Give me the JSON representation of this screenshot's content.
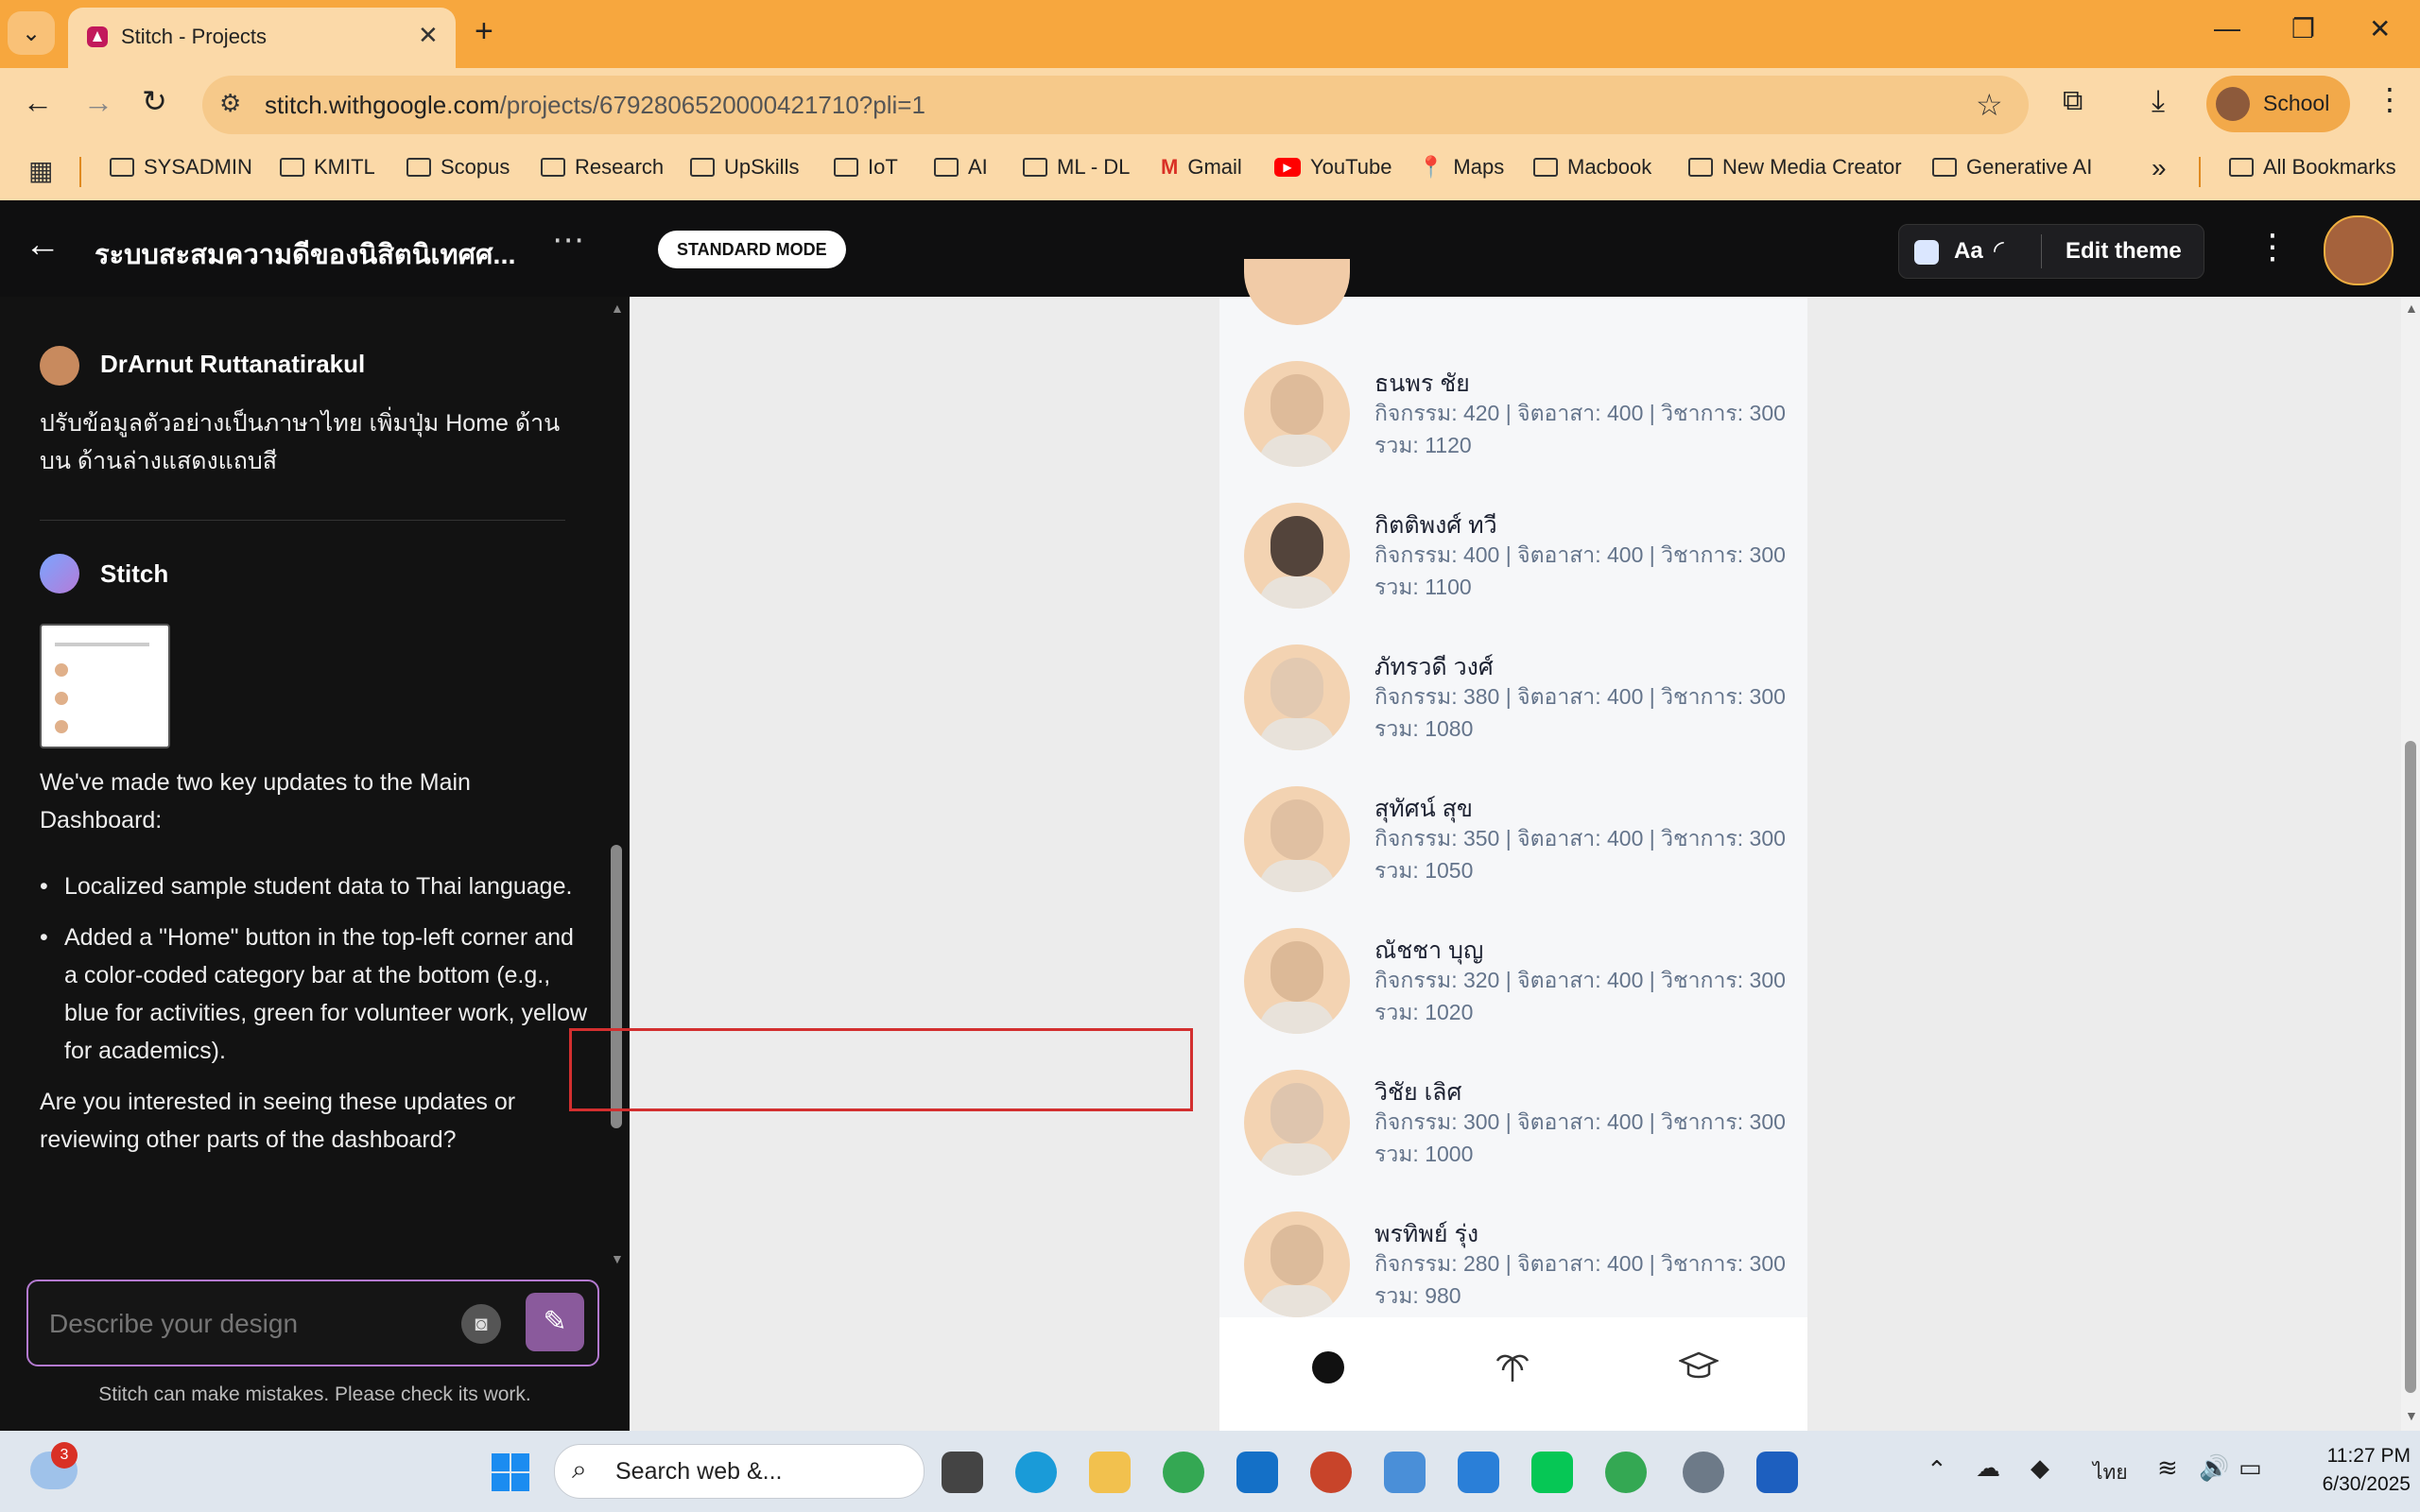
{
  "browser": {
    "tab_title": "Stitch - Projects",
    "url_host": "stitch.withgoogle.com",
    "url_path": "/projects/6792806520000421710?pli=1",
    "profile_label": "School",
    "bookmarks": [
      "SYSADMIN",
      "KMITL",
      "Scopus",
      "Research",
      "UpSkills",
      "IoT",
      "AI",
      "ML - DL",
      "Gmail",
      "YouTube",
      "Maps",
      "Macbook",
      "New Media Creator",
      "Generative AI"
    ],
    "all_bookmarks": "All Bookmarks"
  },
  "app": {
    "project_title": "ระบบสะสมความดีของนิสิตนิเทศศ...",
    "mode_label": "STANDARD MODE",
    "theme_label": "Aa",
    "edit_theme": "Edit theme"
  },
  "chat": {
    "user_name": "DrArnut Ruttanatirakul",
    "user_message": "ปรับข้อมูลตัวอย่างเป็นภาษาไทย เพิ่มปุ่ม Home ด้านบน ด้านล่างแสดงแถบสี",
    "assistant_name": "Stitch",
    "intro": "We've made two key updates to the Main Dashboard:",
    "bullets": [
      "Localized sample student data to Thai language.",
      "Added a \"Home\" button in the top-left corner and a color-coded category bar at the bottom (e.g., blue for activities, green for volunteer work, yellow for academics)."
    ],
    "question": "Are you interested in seeing these updates or reviewing other parts of the dashboard?",
    "input_placeholder": "Describe your design",
    "disclaimer": "Stitch can make mistakes. Please check its work."
  },
  "students": [
    {
      "name": "ธนพร ชัย",
      "scores": "กิจกรรม: 420 | จิตอาสา: 400 | วิชาการ: 300",
      "total": "รวม: 1120",
      "tone": "#f1cba7"
    },
    {
      "name": "กิตติพงศ์ ทวี",
      "scores": "กิจกรรม: 400 | จิตอาสา: 400 | วิชาการ: 300",
      "total": "รวม: 1100",
      "tone": "#5a4a40"
    },
    {
      "name": "ภัทรวดี วงศ์",
      "scores": "กิจกรรม: 380 | จิตอาสา: 400 | วิชาการ: 300",
      "total": "รวม: 1080",
      "tone": "#f6dac0"
    },
    {
      "name": "สุทัศน์ สุข",
      "scores": "กิจกรรม: 350 | จิตอาสา: 400 | วิชาการ: 300",
      "total": "รวม: 1050",
      "tone": "#f3d1b0"
    },
    {
      "name": "ณัชชา บุญ",
      "scores": "กิจกรรม: 320 | จิตอาสา: 400 | วิชาการ: 300",
      "total": "รวม: 1020",
      "tone": "#efc9a4"
    },
    {
      "name": "วิชัย เลิศ",
      "scores": "กิจกรรม: 300 | จิตอาสา: 400 | วิชาการ: 300",
      "total": "รวม: 1000",
      "tone": "#f1d6bd"
    },
    {
      "name": "พรทิพย์ รุ่ง",
      "scores": "กิจกรรม: 280 | จิตอาสา: 400 | วิชาการ: 300",
      "total": "รวม: 980",
      "tone": "#efcba8"
    }
  ],
  "navbar": {
    "icons": [
      "home-dot-icon",
      "palm-tree-icon",
      "graduation-cap-icon"
    ]
  },
  "taskbar": {
    "search_placeholder": "Search web &...",
    "weather_badge": "3",
    "language": "ไทย",
    "time": "11:27 PM",
    "date": "6/30/2025"
  },
  "colors": {
    "tab_strip": "#f7a73e",
    "toolbar": "#fbd9a8",
    "app_header": "#0f0f10",
    "highlight": "#d32f2f"
  }
}
